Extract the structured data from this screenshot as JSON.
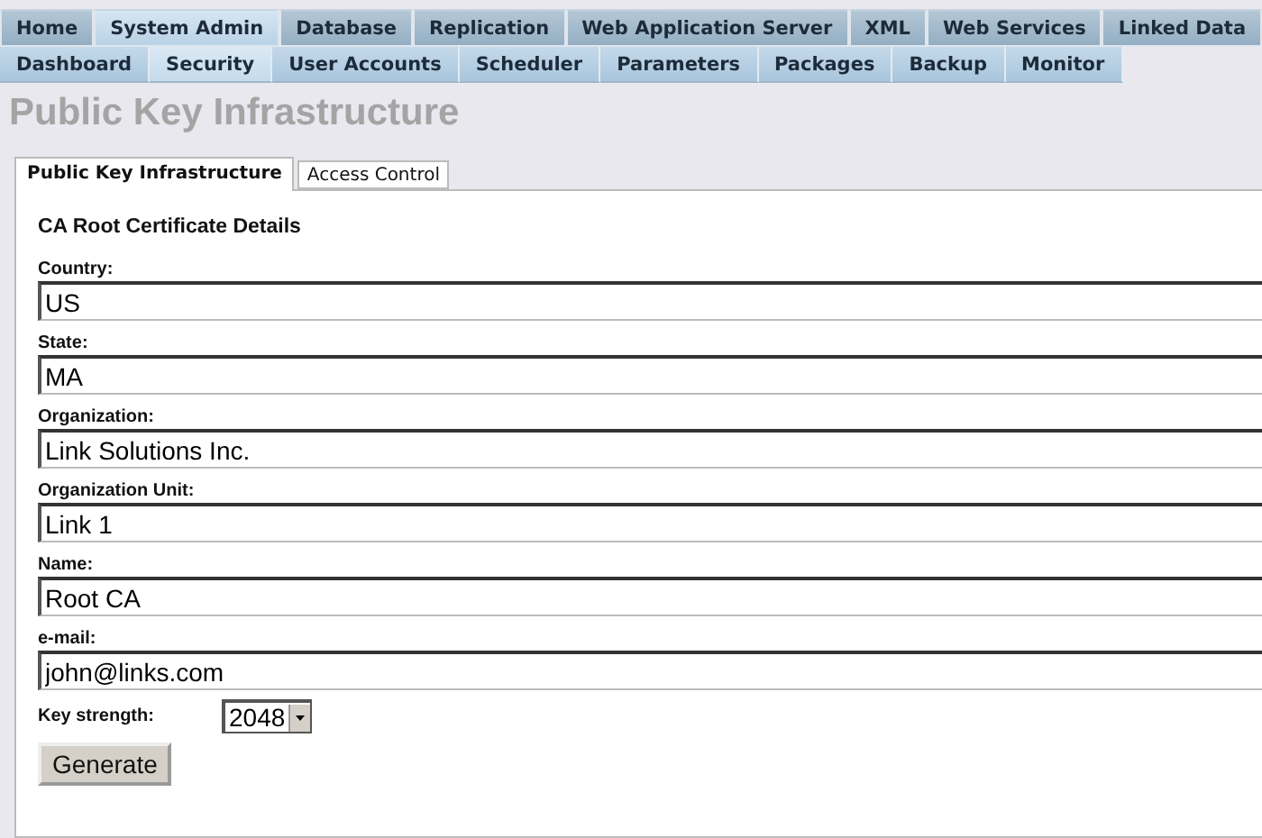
{
  "main_tabs": [
    {
      "label": "Home",
      "selected": false
    },
    {
      "label": "System Admin",
      "selected": true
    },
    {
      "label": "Database",
      "selected": false
    },
    {
      "label": "Replication",
      "selected": false
    },
    {
      "label": "Web Application Server",
      "selected": false
    },
    {
      "label": "XML",
      "selected": false
    },
    {
      "label": "Web Services",
      "selected": false
    },
    {
      "label": "Linked Data",
      "selected": false
    }
  ],
  "sub_tabs": [
    {
      "label": "Dashboard",
      "selected": false
    },
    {
      "label": "Security",
      "selected": true
    },
    {
      "label": "User Accounts",
      "selected": false
    },
    {
      "label": "Scheduler",
      "selected": false
    },
    {
      "label": "Parameters",
      "selected": false
    },
    {
      "label": "Packages",
      "selected": false
    },
    {
      "label": "Backup",
      "selected": false
    },
    {
      "label": "Monitor",
      "selected": false
    }
  ],
  "page_title": "Public Key Infrastructure",
  "panel_tabs": [
    {
      "label": "Public Key Infrastructure",
      "selected": true
    },
    {
      "label": "Access Control",
      "selected": false
    }
  ],
  "section_title": "CA Root Certificate Details",
  "fields": [
    {
      "label": "Country:",
      "value": "US"
    },
    {
      "label": "State:",
      "value": "MA"
    },
    {
      "label": "Organization:",
      "value": "Link Solutions Inc."
    },
    {
      "label": "Organization Unit:",
      "value": "Link 1"
    },
    {
      "label": "Name:",
      "value": "Root CA"
    },
    {
      "label": "e-mail:",
      "value": "john@links.com"
    }
  ],
  "key_strength": {
    "label": "Key strength:",
    "value": "2048"
  },
  "generate_button": "Generate"
}
